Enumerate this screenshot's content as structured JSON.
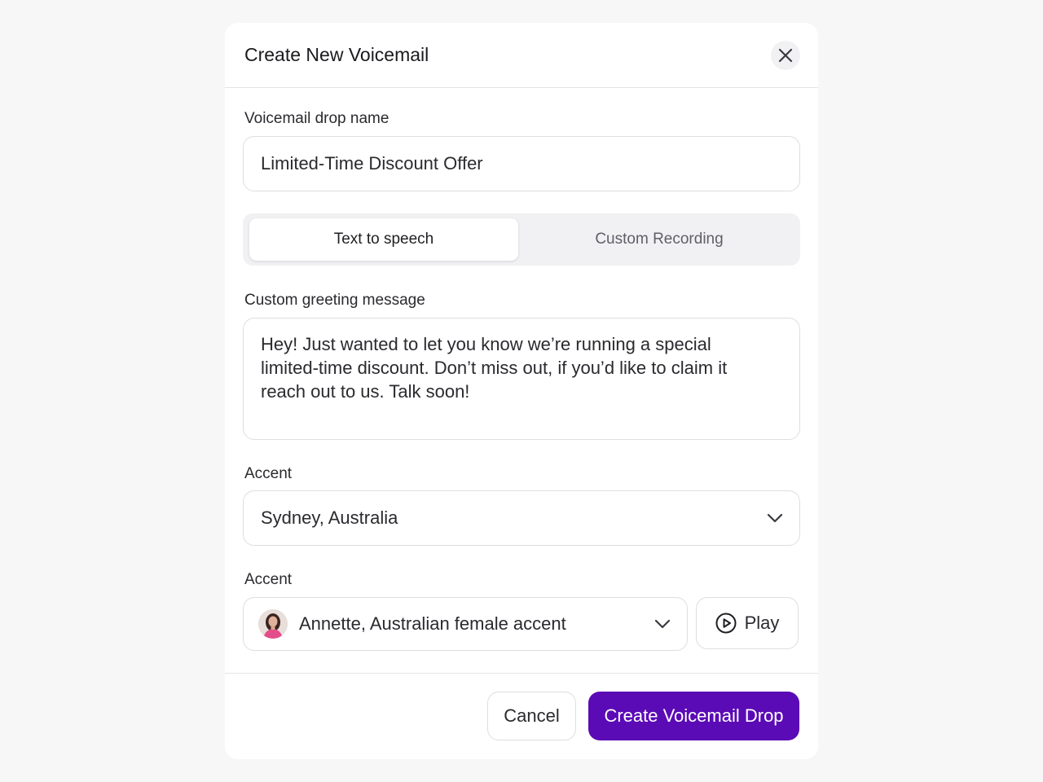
{
  "modal": {
    "title": "Create New Voicemail"
  },
  "form": {
    "name_label": "Voicemail drop name",
    "name_value": "Limited-Time Discount Offer",
    "tabs": [
      {
        "label": "Text to speech",
        "active": true
      },
      {
        "label": "Custom Recording",
        "active": false
      }
    ],
    "greeting_label": "Custom greeting message",
    "greeting_lines": [
      "Hey! Just wanted to let you know we’re running a special",
      "limited-time discount. Don’t miss out, if you’d like to claim it",
      "reach out to us. Talk soon!"
    ],
    "accent_label": "Accent",
    "accent_value": "Sydney, Australia",
    "voice_label": "Accent",
    "voice_value": "Annette, Australian female accent",
    "play_label": "Play"
  },
  "footer": {
    "cancel_label": "Cancel",
    "submit_label": "Create Voicemail Drop"
  },
  "icons": {
    "close": "close-icon",
    "chevron": "chevron-down-icon",
    "play": "play-circle-icon",
    "avatar": "avatar"
  },
  "colors": {
    "primary": "#5b0bb5",
    "border": "#dedee2",
    "segment_bg": "#f1f1f3"
  }
}
